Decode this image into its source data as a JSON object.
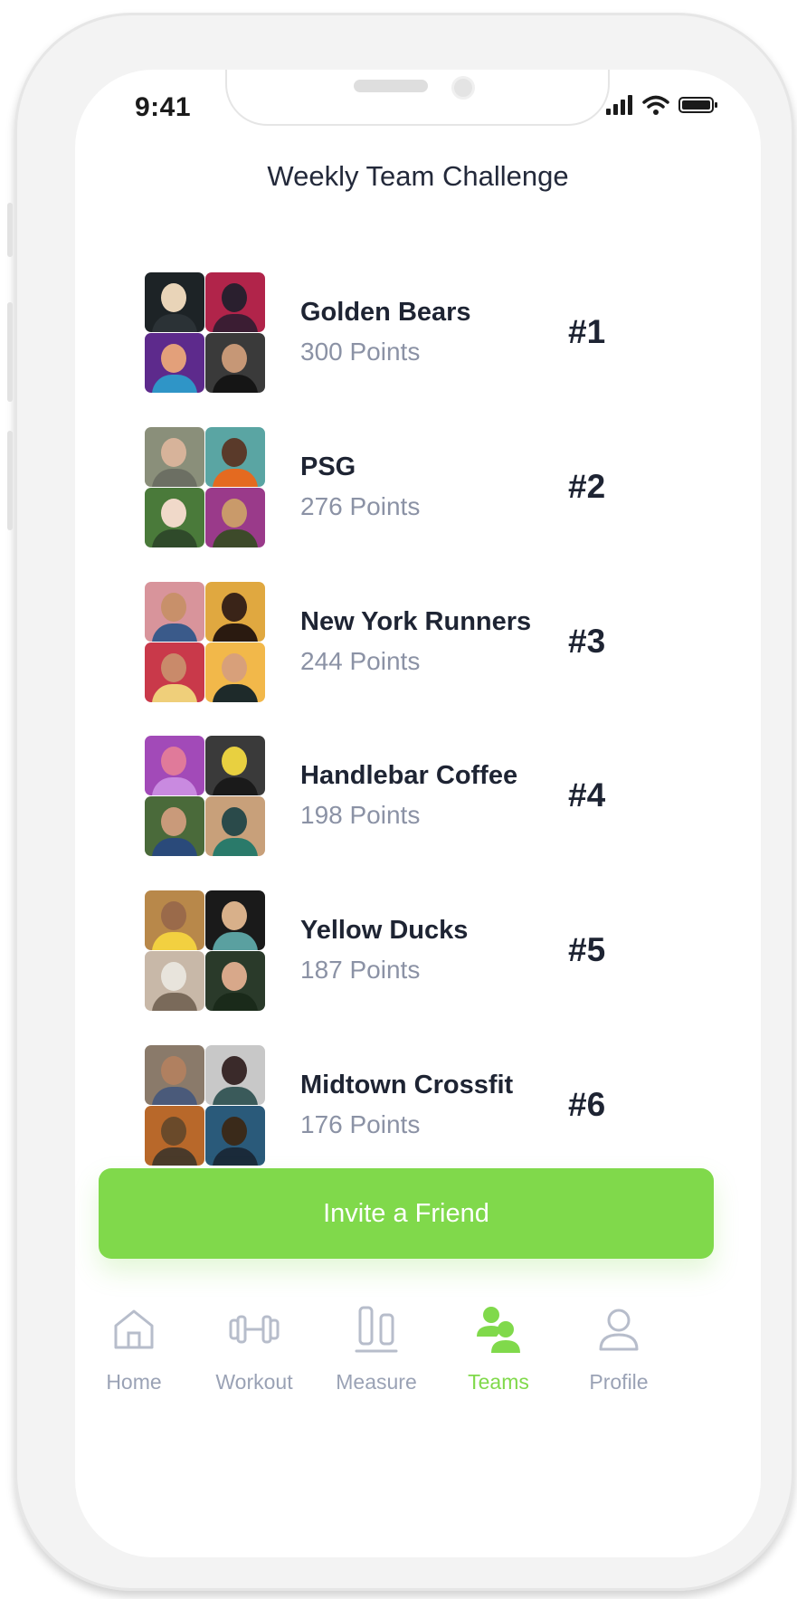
{
  "status_bar": {
    "time": "9:41"
  },
  "page": {
    "title": "Weekly Team Challenge"
  },
  "teams": [
    {
      "name": "Golden Bears",
      "points": "300 Points",
      "rank": "#1"
    },
    {
      "name": "PSG",
      "points": "276 Points",
      "rank": "#2"
    },
    {
      "name": "New York Runners",
      "points": "244 Points",
      "rank": "#3"
    },
    {
      "name": "Handlebar Coffee",
      "points": "198 Points",
      "rank": "#4"
    },
    {
      "name": "Yellow Ducks",
      "points": "187 Points",
      "rank": "#5"
    },
    {
      "name": "Midtown Crossfit",
      "points": "176 Points",
      "rank": "#6"
    }
  ],
  "invite_button": {
    "label": "Invite a Friend"
  },
  "tab_bar": {
    "active": "Teams",
    "tabs": [
      {
        "label": "Home",
        "icon": "home-icon"
      },
      {
        "label": "Workout",
        "icon": "dumbbell-icon"
      },
      {
        "label": "Measure",
        "icon": "measure-icon"
      },
      {
        "label": "Teams",
        "icon": "teams-icon"
      },
      {
        "label": "Profile",
        "icon": "profile-icon"
      }
    ]
  },
  "colors": {
    "accent": "#80d94b",
    "text_primary": "#1e2433",
    "text_secondary": "#8b92a5",
    "tab_inactive": "#9aa2b5"
  }
}
